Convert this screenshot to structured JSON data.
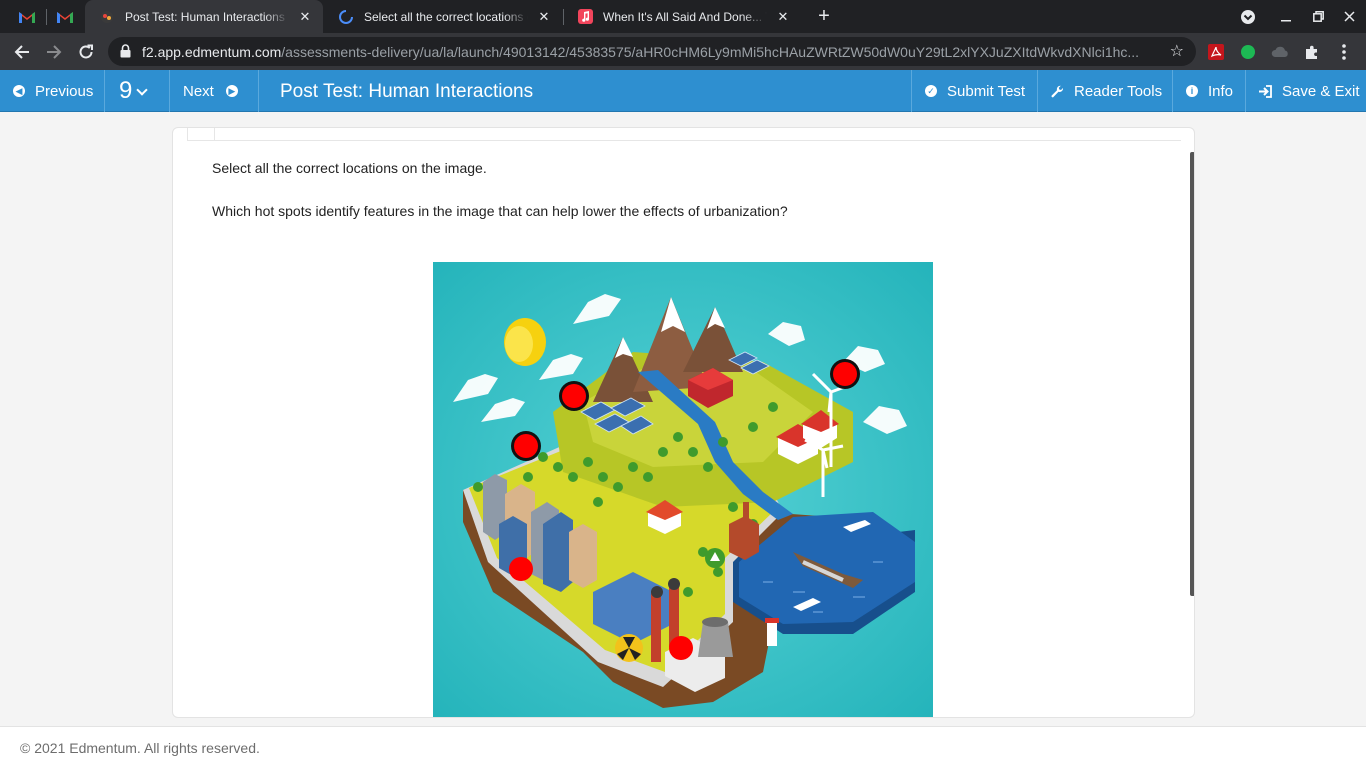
{
  "browser": {
    "tabs": [
      {
        "title": "Post Test: Human Interactions",
        "active": true
      },
      {
        "title": "Select all the correct locations on the image",
        "active": false
      },
      {
        "title": "When It's All Said And Done... Take Time",
        "active": false
      }
    ],
    "url_host": "f2.app.edmentum.com",
    "url_path": "/assessments-delivery/ua/la/launch/49013142/45383575/aHR0cHM6Ly9mMi5hcHAuZWRtZW50dW0uY29tL2xlYXJuZXItdWkvdXNlci1hc..."
  },
  "appbar": {
    "previous_label": "Previous",
    "question_number": "9",
    "next_label": "Next",
    "title": "Post Test: Human Interactions",
    "submit_label": "Submit Test",
    "reader_tools_label": "Reader Tools",
    "info_label": "Info",
    "save_exit_label": "Save & Exit"
  },
  "question": {
    "instruction": "Select all the correct locations on the image.",
    "text": "Which hot spots identify features in the image that can help lower the effects of urbanization?",
    "hotspot_count": 5,
    "hotspots": [
      {
        "name": "hotspot-solar-panels",
        "feature": "solar panels"
      },
      {
        "name": "hotspot-forest",
        "feature": "forest"
      },
      {
        "name": "hotspot-wind-turbine",
        "feature": "wind turbine"
      },
      {
        "name": "hotspot-city-buildings",
        "feature": "city buildings"
      },
      {
        "name": "hotspot-factory",
        "feature": "factory"
      }
    ]
  },
  "colors": {
    "appbar": "#2e8fd0",
    "hotspot": "#ff0000",
    "sea": "#1f6fb8",
    "background_teal": "#3cc4c9"
  },
  "footer": {
    "copyright": "© 2021 Edmentum. All rights reserved."
  }
}
